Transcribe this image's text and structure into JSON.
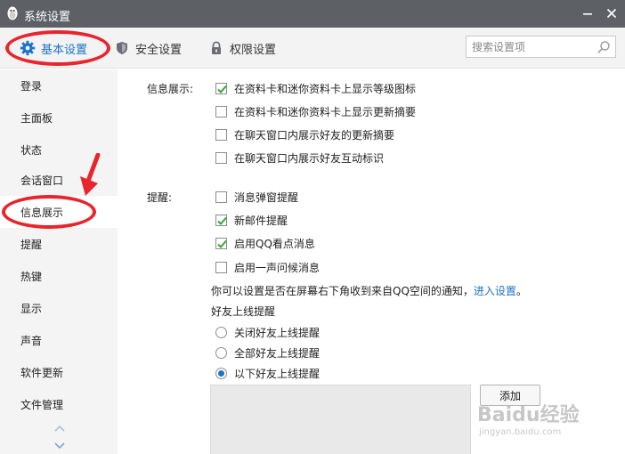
{
  "window": {
    "title": "系统设置",
    "accent_color": "#1a73c9",
    "titlebar_color": "#5d6166"
  },
  "tabs": [
    {
      "label": "基本设置",
      "icon": "gear-icon",
      "active": true
    },
    {
      "label": "安全设置",
      "icon": "shield-icon",
      "active": false
    },
    {
      "label": "权限设置",
      "icon": "lock-icon",
      "active": false
    }
  ],
  "search": {
    "placeholder": "搜索设置项",
    "value": ""
  },
  "sidebar": {
    "items": [
      {
        "label": "登录"
      },
      {
        "label": "主面板"
      },
      {
        "label": "状态"
      },
      {
        "label": "会话窗口"
      },
      {
        "label": "信息展示",
        "selected": true
      },
      {
        "label": "提醒"
      },
      {
        "label": "热键"
      },
      {
        "label": "显示"
      },
      {
        "label": "声音"
      },
      {
        "label": "软件更新"
      },
      {
        "label": "文件管理"
      }
    ]
  },
  "info_display": {
    "label": "信息展示:",
    "options": [
      {
        "label": "在资料卡和迷你资料卡上显示等级图标",
        "checked": true
      },
      {
        "label": "在资料卡和迷你资料卡上显示更新摘要",
        "checked": false
      },
      {
        "label": "在聊天窗口内展示好友的更新摘要",
        "checked": false
      },
      {
        "label": "在聊天窗口内展示好友互动标识",
        "checked": false
      }
    ]
  },
  "reminder": {
    "label": "提醒:",
    "options": [
      {
        "label": "消息弹窗提醒",
        "checked": false
      },
      {
        "label": "新邮件提醒",
        "checked": true
      },
      {
        "label": "启用QQ看点消息",
        "checked": true
      },
      {
        "label": "启用一声问候消息",
        "checked": false
      }
    ],
    "note_text": "你可以设置是否在屏幕右下角收到来自QQ空间的通知，",
    "note_link": "进入设置",
    "note_end": "。",
    "friend_online_title": "好友上线提醒",
    "friend_online_options": [
      {
        "label": "关闭好友上线提醒",
        "selected": false
      },
      {
        "label": "全部好友上线提醒",
        "selected": false
      },
      {
        "label": "以下好友上线提醒",
        "selected": true
      }
    ],
    "add_button": "添加"
  },
  "watermark": {
    "main": "Baidu经验",
    "sub": "jingyan.baidu.com"
  }
}
